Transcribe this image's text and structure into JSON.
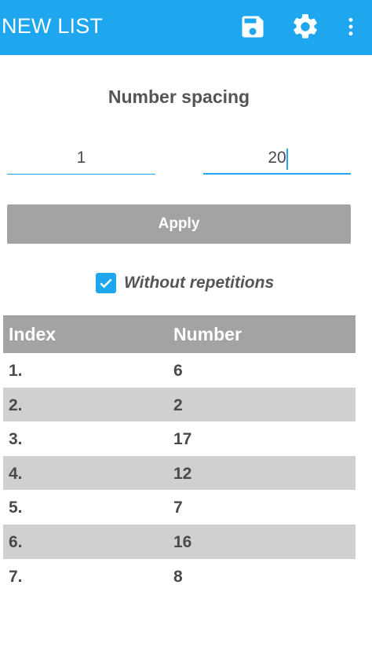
{
  "appbar": {
    "title": "NEW LIST",
    "actions": {
      "save_icon": "floppy-disk-icon",
      "settings_icon": "gear-icon",
      "more_icon": "vertical-dots-icon"
    },
    "color": "#1ea6ee"
  },
  "spacing": {
    "title": "Number spacing",
    "from_value": "1",
    "to_value": "20"
  },
  "apply_button": {
    "label": "Apply"
  },
  "options": {
    "without_repetitions_label": "Without repetitions",
    "without_repetitions_checked": true
  },
  "table": {
    "headers": {
      "index": "Index",
      "number": "Number"
    },
    "rows": [
      {
        "index": "1.",
        "number": "6"
      },
      {
        "index": "2.",
        "number": "2"
      },
      {
        "index": "3.",
        "number": "17"
      },
      {
        "index": "4.",
        "number": "12"
      },
      {
        "index": "5.",
        "number": "7"
      },
      {
        "index": "6.",
        "number": "16"
      },
      {
        "index": "7.",
        "number": "8"
      }
    ]
  }
}
